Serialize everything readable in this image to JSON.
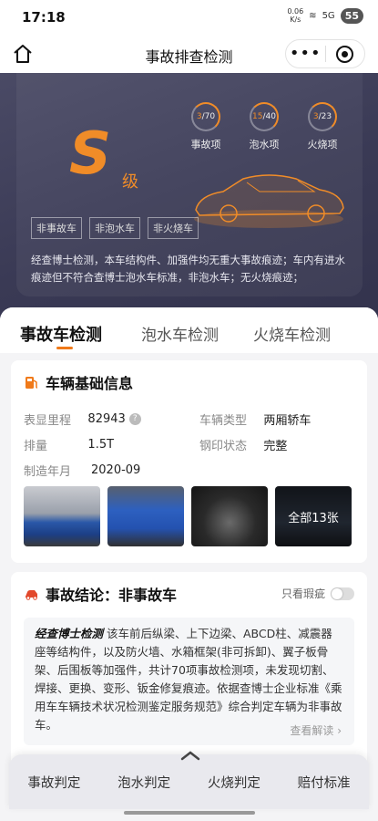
{
  "status": {
    "time": "17:18",
    "net_speed": "0.06",
    "net_unit": "K/s",
    "signal": "5G",
    "battery": "55"
  },
  "nav": {
    "title": "事故排查检测",
    "more": "•••"
  },
  "hero": {
    "grade": "S",
    "grade_suffix": "级",
    "gauges": [
      {
        "num": "3",
        "total": "/70",
        "label": "事故项"
      },
      {
        "num": "15",
        "total": "/40",
        "label": "泡水项"
      },
      {
        "num": "3",
        "total": "/23",
        "label": "火烧项"
      }
    ],
    "tags": [
      "非事故车",
      "非泡水车",
      "非火烧车"
    ],
    "description": "经查博士检测，本车结构件、加强件均无重大事故痕迹；车内有进水痕迹但不符合查博士泡水车标准，非泡水车；无火烧痕迹；"
  },
  "tabs": [
    "事故车检测",
    "泡水车检测",
    "火烧车检测"
  ],
  "vehicle_info": {
    "title": "车辆基础信息",
    "rows": [
      {
        "k1": "表显里程",
        "v1": "82943",
        "k2": "车辆类型",
        "v2": "两厢轿车"
      },
      {
        "k1": "排量",
        "v1": "1.5T",
        "k2": "钢印状态",
        "v2": "完整"
      },
      {
        "k1": "制造年月",
        "v1": "2020-09",
        "k2": "",
        "v2": ""
      }
    ],
    "photos_more": "全部13张"
  },
  "conclusion": {
    "title": "事故结论：非事故车",
    "only_flaw": "只看瑕疵",
    "brand": "经查博士检测",
    "text": "该车前后纵梁、上下边梁、ABCD柱、减震器座等结构件，以及防火墙、水箱框架(非可拆卸)、翼子板骨架、后围板等加强件，共计70项事故检测项，未发现切割、焊接、更换、变形、钣金修复痕迹。依据查博士企业标准《乘用车车辆技术状况检测鉴定服务规范》综合判定车辆为非事故车。",
    "view_more": "查看解读 ›"
  },
  "bottom_nav": [
    "事故判定",
    "泡水判定",
    "火烧判定",
    "赔付标准"
  ],
  "colors": {
    "accent": "#f07a1a",
    "hero_bg": "#3d3d58"
  }
}
